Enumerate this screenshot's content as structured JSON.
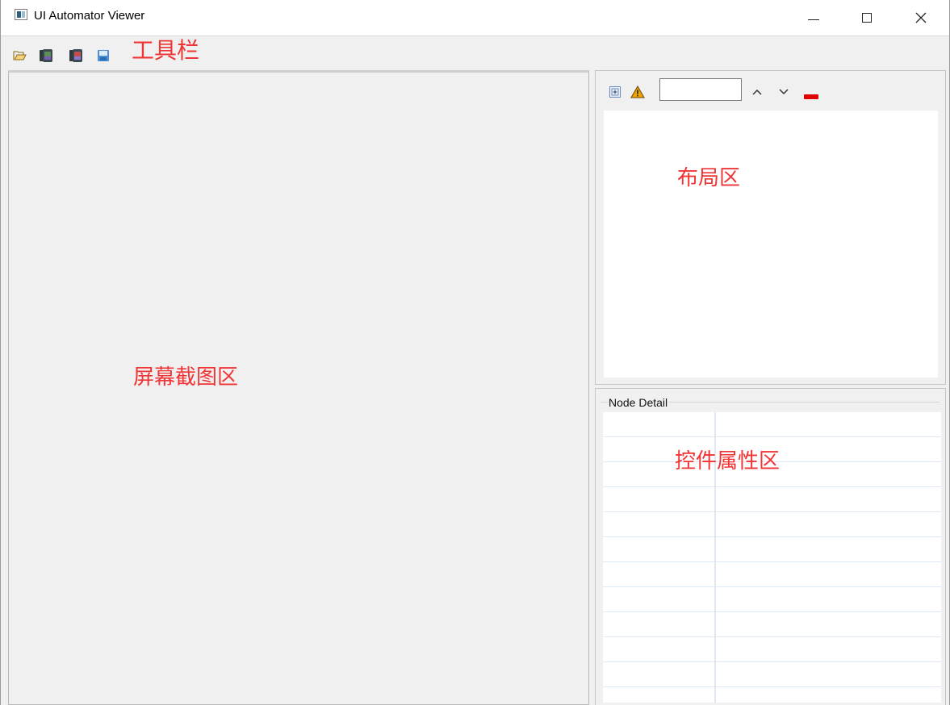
{
  "window": {
    "title": "UI Automator Viewer"
  },
  "toolbar": {
    "icons": [
      "open-folder-icon",
      "device-screenshot-icon",
      "device-screenshot-compressed-icon",
      "save-icon"
    ]
  },
  "annotations": {
    "toolbar": "工具栏",
    "layout": "布局区",
    "screenshot": "屏幕截图区",
    "properties": "控件属性区"
  },
  "layout_toolbar": {
    "search_value": "",
    "icons": [
      "expand-all-icon",
      "warning-icon",
      "previous-match-icon",
      "next-match-icon",
      "clear-icon"
    ]
  },
  "node_detail": {
    "label": "Node Detail",
    "rows": 12
  },
  "colors": {
    "annotation": "#f03434",
    "warning": "#f0a400",
    "clear": "#e00000"
  }
}
